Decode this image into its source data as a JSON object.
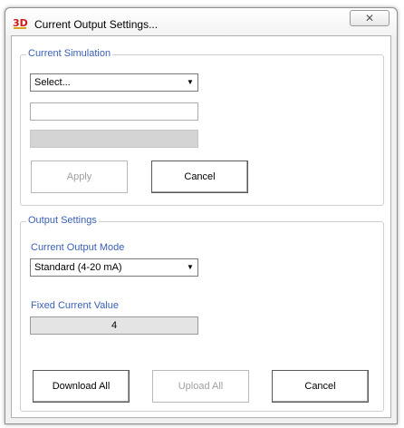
{
  "window": {
    "title": "Current Output Settings...",
    "close_glyph": "✕"
  },
  "current_simulation": {
    "group_label": "Current Simulation",
    "select_value": "Select...",
    "text_field_value": "",
    "readonly_field_value": "",
    "apply_label": "Apply",
    "cancel_label": "Cancel"
  },
  "output_settings": {
    "group_label": "Output Settings",
    "mode_label": "Current Output Mode",
    "mode_value": "Standard (4-20 mA)",
    "fixed_label": "Fixed Current Value",
    "fixed_value": "4"
  },
  "footer": {
    "download_all_label": "Download All",
    "upload_all_label": "Upload All",
    "cancel_label": "Cancel"
  },
  "colors": {
    "group_label": "#3a5fb5",
    "disabled_text": "#a0a0a0"
  }
}
